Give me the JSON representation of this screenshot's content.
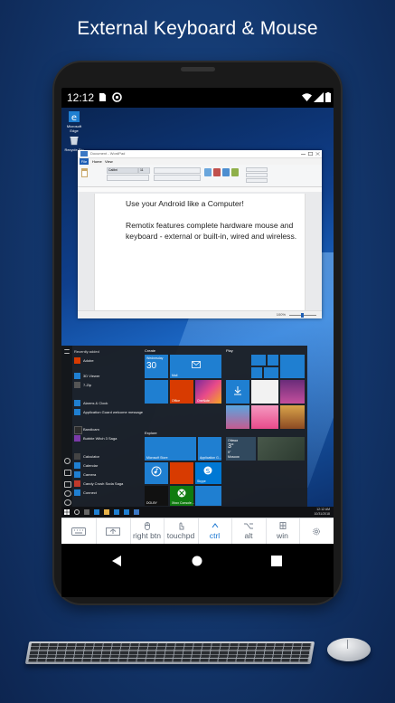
{
  "headline": "External Keyboard & Mouse",
  "status_bar": {
    "time": "12:12"
  },
  "desktop": {
    "icons": [
      {
        "label_line1": "Microsoft",
        "label_line2": "Edge"
      },
      {
        "label_line1": "Recycle Bin",
        "label_line2": ""
      }
    ]
  },
  "wordpad": {
    "title": "Document - WordPad",
    "menu": {
      "file": "File",
      "home": "Home",
      "view": "View"
    },
    "font_name": "Calibri",
    "font_size": "11",
    "paragraphs": [
      "Use your Android like a Computer!",
      "Remotix features complete hardware mouse and keyboard - external or built-in, wired and wireless."
    ],
    "zoom": "100%"
  },
  "start_menu": {
    "recently_added": "Recently added",
    "app_list": [
      "Adobe",
      "3D Viewer",
      "7-Zip",
      "Alarms & Clock",
      "Application Guard welcome message",
      "Bandicam",
      "Bubble Witch 3 Saga",
      "Calculator",
      "Calendar",
      "Camera",
      "Candy Crush Soda Saga",
      "Connect"
    ],
    "groups": {
      "create": "Create",
      "play": "Play",
      "explore": "Explore"
    },
    "tiles": {
      "calendar_day": "Wednesday",
      "calendar_date": "30",
      "mail": "Mail",
      "office": "Office",
      "onenote": "OneNote",
      "store": "Microsoft Store",
      "app_guard": "Application G...",
      "weather_city": "Ottawa",
      "weather_temp": "3°",
      "weather_low": "5°",
      "weather_city2": "Moscow",
      "xbox": "Xbox Console...",
      "dolby": "DOLBY",
      "skype": "Skype"
    }
  },
  "taskbar": {
    "time": "12:12 AM",
    "date": "10/31/2018"
  },
  "keyboard_toolbar": {
    "buttons": [
      "",
      "",
      "right btn",
      "touchpd",
      "ctrl",
      "alt",
      "win",
      ""
    ]
  },
  "colors": {
    "accent": "#1976d2",
    "background": "#143a72",
    "tile_blue": "#1f7fd1",
    "office_red": "#d83b01",
    "onenote_purple": "#7b2a9a",
    "xbox_green": "#107c10",
    "skype_blue": "#0078d4"
  }
}
